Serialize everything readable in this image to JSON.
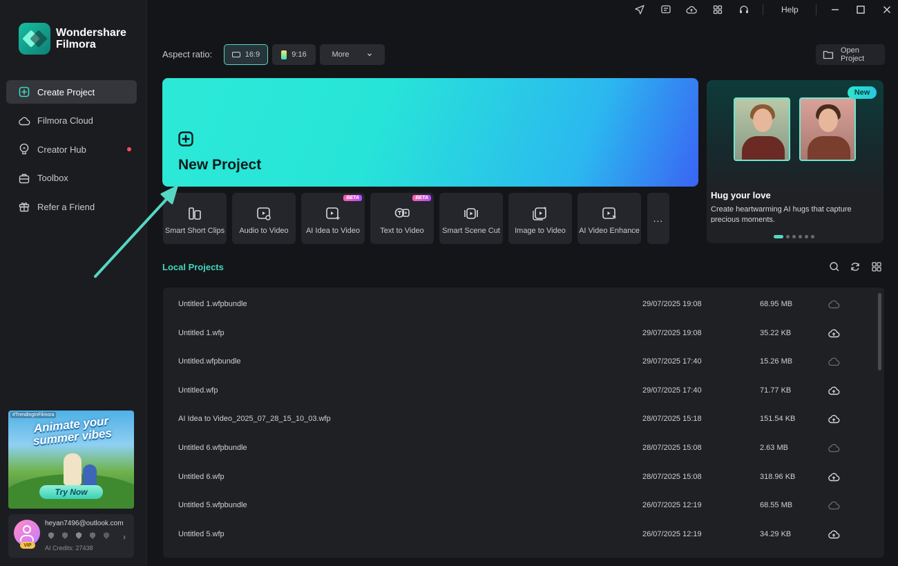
{
  "app": {
    "logo_line1": "Wondershare",
    "logo_line2": "Filmora"
  },
  "sidebar": {
    "items": [
      {
        "label": "Create Project",
        "icon": "plus-square-icon",
        "active": true
      },
      {
        "label": "Filmora Cloud",
        "icon": "cloud-icon"
      },
      {
        "label": "Creator Hub",
        "icon": "lightbulb-icon",
        "notification": true
      },
      {
        "label": "Toolbox",
        "icon": "toolbox-icon"
      },
      {
        "label": "Refer a Friend",
        "icon": "gift-icon"
      }
    ],
    "promo": {
      "tag": "#TrendingInFilmora",
      "title": "Animate your summer vibes",
      "button": "Try Now"
    },
    "account": {
      "email": "heyan7496@outlook.com",
      "vip": "VIP",
      "credits": "AI Credits: 27438"
    }
  },
  "titlebar": {
    "help": "Help"
  },
  "aspect": {
    "label": "Aspect ratio:",
    "options": [
      {
        "label": "16:9",
        "selected": true
      },
      {
        "label": "9:16"
      }
    ],
    "more": "More"
  },
  "open_project": "Open Project",
  "new_project": {
    "title": "New Project"
  },
  "tools": [
    {
      "label": "Smart Short Clips",
      "icon": "smart-short-clips-icon"
    },
    {
      "label": "Audio to Video",
      "icon": "audio-to-video-icon"
    },
    {
      "label": "AI Idea to Video",
      "icon": "ai-idea-to-video-icon",
      "beta": "BETA"
    },
    {
      "label": "Text to Video",
      "icon": "text-to-video-icon",
      "beta": "BETA"
    },
    {
      "label": "Smart Scene Cut",
      "icon": "smart-scene-cut-icon"
    },
    {
      "label": "Image to Video",
      "icon": "image-to-video-icon"
    },
    {
      "label": "AI Video Enhance",
      "icon": "ai-video-enhance-icon"
    }
  ],
  "tools_more": "...",
  "banner": {
    "badge": "New",
    "title": "Hug your love",
    "description": "Create heartwarming AI hugs that capture precious moments."
  },
  "local_projects": {
    "title": "Local Projects",
    "rows": [
      {
        "name": "Untitled 1.wfpbundle",
        "date": "29/07/2025 19:08",
        "size": "68.95 MB",
        "cloud": "cloud-synced-icon"
      },
      {
        "name": "Untitled 1.wfp",
        "date": "29/07/2025 19:08",
        "size": "35.22 KB",
        "cloud": "cloud-upload-icon"
      },
      {
        "name": "Untitled.wfpbundle",
        "date": "29/07/2025 17:40",
        "size": "15.26 MB",
        "cloud": "cloud-synced-icon"
      },
      {
        "name": "Untitled.wfp",
        "date": "29/07/2025 17:40",
        "size": "71.77 KB",
        "cloud": "cloud-upload-icon"
      },
      {
        "name": "AI Idea to Video_2025_07_28_15_10_03.wfp",
        "date": "28/07/2025 15:18",
        "size": "151.54 KB",
        "cloud": "cloud-upload-icon"
      },
      {
        "name": "Untitled 6.wfpbundle",
        "date": "28/07/2025 15:08",
        "size": "2.63 MB",
        "cloud": "cloud-synced-icon"
      },
      {
        "name": "Untitled 6.wfp",
        "date": "28/07/2025 15:08",
        "size": "318.96 KB",
        "cloud": "cloud-upload-icon"
      },
      {
        "name": "Untitled 5.wfpbundle",
        "date": "26/07/2025 12:19",
        "size": "68.55 MB",
        "cloud": "cloud-synced-icon"
      },
      {
        "name": "Untitled 5.wfp",
        "date": "26/07/2025 12:19",
        "size": "34.29 KB",
        "cloud": "cloud-upload-icon"
      }
    ]
  },
  "colors": {
    "accent": "#41d6c0",
    "new_project_start": "#2ce9d7",
    "new_project_end": "#3a64f4"
  }
}
